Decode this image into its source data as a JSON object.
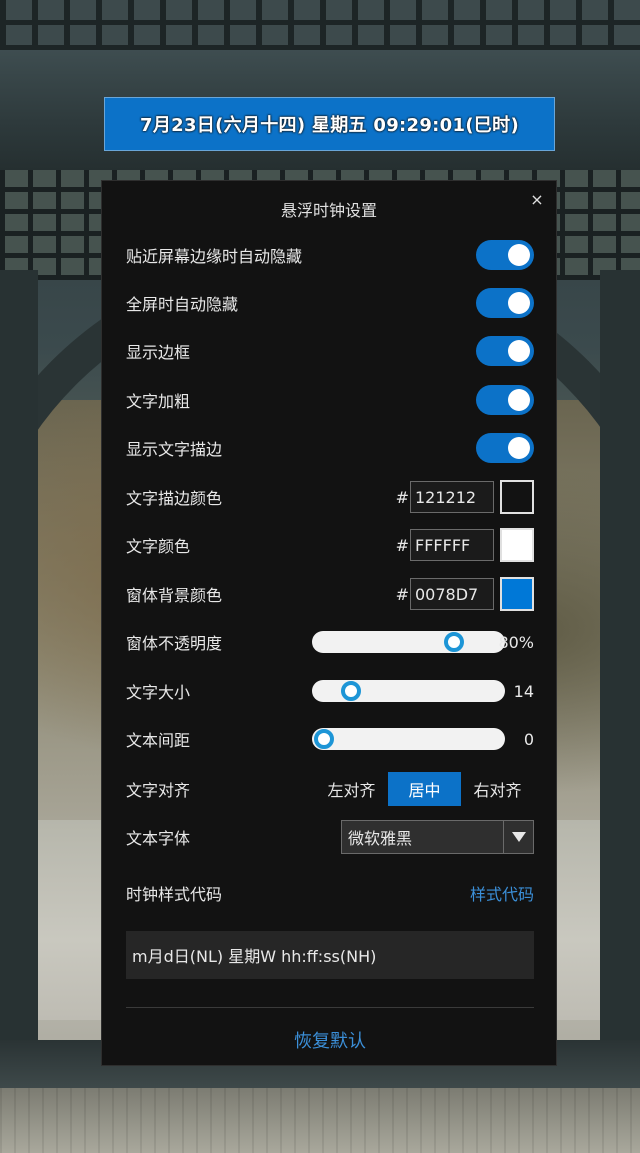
{
  "clock": {
    "text": "7月23日(六月十四) 星期五 09:29:01(巳时)"
  },
  "panel": {
    "title": "悬浮时钟设置",
    "close_symbol": "×",
    "toggles": [
      {
        "label": "贴近屏幕边缘时自动隐藏",
        "on": true
      },
      {
        "label": "全屏时自动隐藏",
        "on": true
      },
      {
        "label": "显示边框",
        "on": true
      },
      {
        "label": "文字加粗",
        "on": true
      },
      {
        "label": "显示文字描边",
        "on": true
      }
    ],
    "colors": [
      {
        "label": "文字描边颜色",
        "hash": "#",
        "hex": "121212",
        "swatch": "#121212"
      },
      {
        "label": "文字颜色",
        "hash": "#",
        "hex": "FFFFFF",
        "swatch": "#FFFFFF"
      },
      {
        "label": "窗体背景颜色",
        "hash": "#",
        "hex": "0078D7",
        "swatch": "#0078D7"
      }
    ],
    "sliders": [
      {
        "label": "窗体不透明度",
        "value_text": "80%",
        "position_fraction": 0.77
      },
      {
        "label": "文字大小",
        "value_text": "14",
        "position_fraction": 0.16
      },
      {
        "label": "文本间距",
        "value_text": "0",
        "position_fraction": 0.0
      }
    ],
    "align": {
      "label": "文字对齐",
      "options": [
        "左对齐",
        "居中",
        "右对齐"
      ],
      "selected_index": 1
    },
    "font": {
      "label": "文本字体",
      "value": "微软雅黑"
    },
    "style_code": {
      "label": "时钟样式代码",
      "link": "样式代码",
      "value": "m月d日(NL) 星期W hh:ff:ss(NH)"
    },
    "restore_label": "恢复默认"
  },
  "colors": {
    "accent": "#0C72C8",
    "link": "#3B8FD8",
    "panel_bg": "#121212",
    "slider_thumb": "#1D95D6"
  }
}
